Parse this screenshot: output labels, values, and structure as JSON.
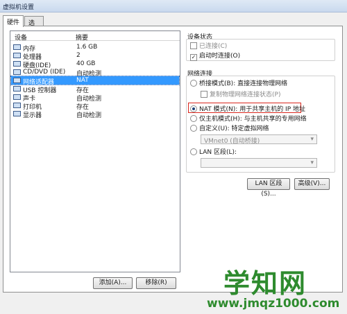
{
  "window": {
    "title": "虚拟机设置"
  },
  "tabs": [
    {
      "label": "硬件"
    },
    {
      "label": "选项"
    }
  ],
  "device_list": {
    "header": {
      "device": "设备",
      "summary": "摘要"
    },
    "rows": [
      {
        "device": "内存",
        "summary": "1.6 GB",
        "icon": "memory-icon"
      },
      {
        "device": "处理器",
        "summary": "2",
        "icon": "processor-icon"
      },
      {
        "device": "硬盘(IDE)",
        "summary": "40 GB",
        "icon": "hard-disk-icon"
      },
      {
        "device": "CD/DVD (IDE)",
        "summary": "自动检测",
        "icon": "cd-dvd-icon"
      },
      {
        "device": "网络适配器",
        "summary": "NAT",
        "icon": "network-adapter-icon",
        "selected": true
      },
      {
        "device": "USB 控制器",
        "summary": "存在",
        "icon": "usb-controller-icon"
      },
      {
        "device": "声卡",
        "summary": "自动检测",
        "icon": "sound-card-icon"
      },
      {
        "device": "打印机",
        "summary": "存在",
        "icon": "printer-icon"
      },
      {
        "device": "显示器",
        "summary": "自动检测",
        "icon": "display-icon"
      }
    ]
  },
  "buttons": {
    "add": "添加(A)...",
    "remove": "移除(R)",
    "lan_segments": "LAN 区段(S)...",
    "advanced": "高级(V)..."
  },
  "device_status": {
    "title": "设备状态",
    "connected": {
      "label": "已连接(C)",
      "checked": false,
      "enabled": false
    },
    "connect_at_power_on": {
      "label": "启动时连接(O)",
      "checked": true
    }
  },
  "network_connection": {
    "title": "网络连接",
    "bridged": {
      "label": "桥接模式(B): 直接连接物理网络",
      "selected": false
    },
    "replicate": {
      "label": "复制物理网络连接状态(P)",
      "enabled": false
    },
    "nat": {
      "label": "NAT 模式(N): 用于共享主机的 IP 地址",
      "selected": true
    },
    "host_only": {
      "label": "仅主机模式(H): 与主机共享的专用网络",
      "selected": false
    },
    "custom": {
      "label": "自定义(U): 特定虚拟网络",
      "selected": false
    },
    "custom_select": {
      "value": "VMnet0 (自动桥接)"
    },
    "lan_segment": {
      "label": "LAN 区段(L):",
      "selected": false
    },
    "lan_select": {
      "value": ""
    }
  },
  "watermark": {
    "text": "学知网",
    "url": "www.jmqz1000.com"
  },
  "colors": {
    "selection": "#3399ff",
    "highlight": "#d9261c",
    "watermark": "#2e8b2e"
  }
}
